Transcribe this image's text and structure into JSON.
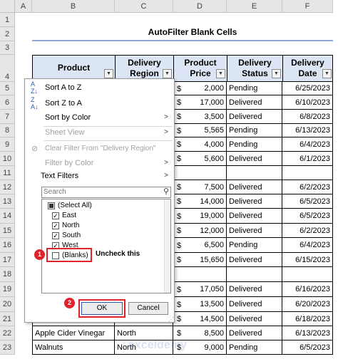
{
  "columns": [
    "A",
    "B",
    "C",
    "D",
    "E",
    "F"
  ],
  "rows": [
    "1",
    "2",
    "3",
    "4",
    "5",
    "6",
    "7",
    "8",
    "9",
    "10",
    "11",
    "12",
    "13",
    "14",
    "15",
    "16",
    "17",
    "18",
    "19",
    "20",
    "21",
    "22",
    "23"
  ],
  "title": "AutoFilter Blank Cells",
  "headers": {
    "product": "Product",
    "region_l1": "Delivery",
    "region_l2": "Region",
    "price_l1": "Product",
    "price_l2": "Price",
    "status_l1": "Delivery",
    "status_l2": "Status",
    "date_l1": "Delivery",
    "date_l2": "Date"
  },
  "table_rows": [
    {
      "price": "2,000",
      "status": "Pending",
      "date": "6/25/2023"
    },
    {
      "price": "17,000",
      "status": "Delivered",
      "date": "6/10/2023"
    },
    {
      "price": "3,500",
      "status": "Delivered",
      "date": "6/8/2023"
    },
    {
      "price": "5,565",
      "status": "Pending",
      "date": "6/13/2023"
    },
    {
      "price": "4,000",
      "status": "Pending",
      "date": "6/4/2023"
    },
    {
      "price": "5,600",
      "status": "Delivered",
      "date": "6/1/2023"
    },
    {
      "price": "",
      "status": "",
      "date": ""
    },
    {
      "price": "7,500",
      "status": "Delivered",
      "date": "6/2/2023"
    },
    {
      "price": "14,000",
      "status": "Delivered",
      "date": "6/5/2023"
    },
    {
      "price": "19,000",
      "status": "Delivered",
      "date": "6/5/2023"
    },
    {
      "price": "12,000",
      "status": "Delivered",
      "date": "6/2/2023"
    },
    {
      "price": "6,500",
      "status": "Pending",
      "date": "6/4/2023"
    },
    {
      "price": "15,650",
      "status": "Delivered",
      "date": "6/15/2023"
    },
    {
      "price": "",
      "status": "",
      "date": ""
    },
    {
      "price": "17,050",
      "status": "Delivered",
      "date": "6/16/2023"
    },
    {
      "price": "13,500",
      "status": "Delivered",
      "date": "6/20/2023"
    },
    {
      "price": "14,500",
      "status": "Delivered",
      "date": "6/18/2023"
    },
    {
      "product": "Apple Cider Vinegar",
      "region": "North",
      "price": "8,500",
      "status": "Delivered",
      "date": "6/13/2023"
    },
    {
      "product": "Walnuts",
      "region": "North",
      "price": "9,000",
      "status": "Pending",
      "date": "6/5/2023"
    }
  ],
  "currency": "$",
  "menu": {
    "sort_az": "Sort A to Z",
    "sort_za": "Sort Z to A",
    "sort_color": "Sort by Color",
    "sheet_view": "Sheet View",
    "clear_filter": "Clear Filter From \"Delivery Region\"",
    "filter_color": "Filter by Color",
    "text_filters": "Text Filters",
    "search_placeholder": "Search",
    "items": [
      {
        "label": "(Select All)",
        "state": "mixed"
      },
      {
        "label": "East",
        "state": "checked"
      },
      {
        "label": "North",
        "state": "checked"
      },
      {
        "label": "South",
        "state": "checked"
      },
      {
        "label": "West",
        "state": "checked"
      },
      {
        "label": "(Blanks)",
        "state": "unchecked"
      }
    ],
    "ok": "OK",
    "cancel": "Cancel"
  },
  "annotations": {
    "badge1": "1",
    "badge2": "2",
    "uncheck_note": "Uncheck this"
  },
  "watermark": "exceldemy",
  "colors": {
    "accent": "#e0222a",
    "header_fill": "#dbe5f4",
    "title_line": "#8fa8d6"
  }
}
